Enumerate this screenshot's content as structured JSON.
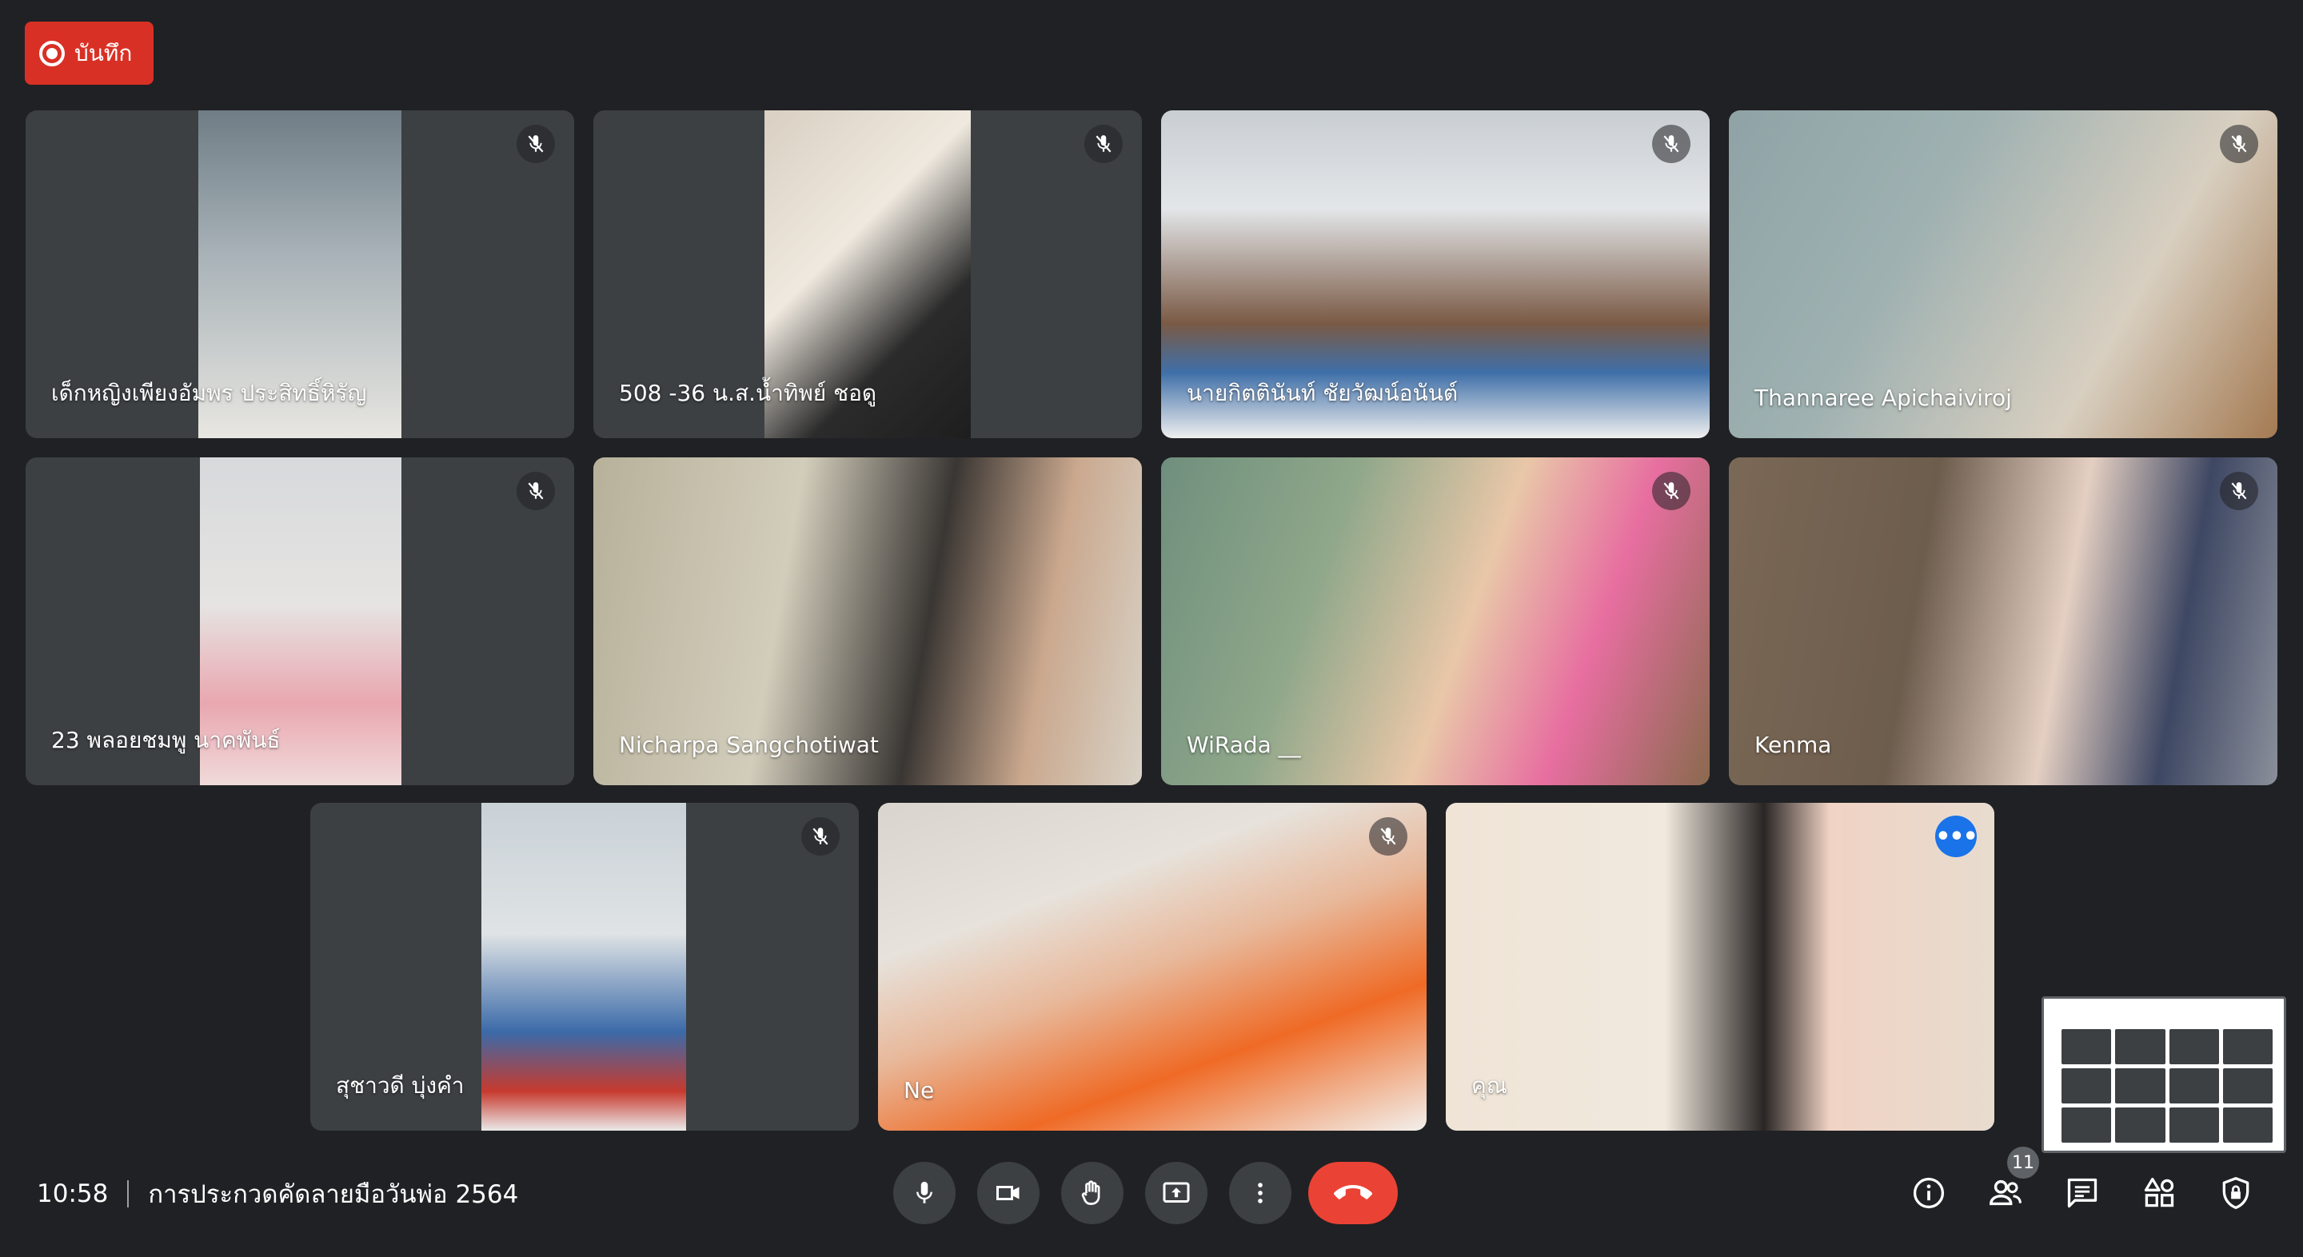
{
  "recording": {
    "label": "บันทึก"
  },
  "participants": [
    {
      "name": "เด็กหญิงเพียงอัมพร ประสิทธิ์หิรัญ",
      "muted": true
    },
    {
      "name": "508 -36 น.ส.น้ำทิพย์ ชอดู",
      "muted": true
    },
    {
      "name": "นายกิตตินันท์ ชัยวัฒน์อนันต์",
      "muted": true
    },
    {
      "name": "Thannaree Apichaiviroj",
      "muted": true
    },
    {
      "name": "23 พลอยชมพู นาคพันธ์",
      "muted": true
    },
    {
      "name": "Nicharpa Sangchotiwat",
      "muted": false
    },
    {
      "name": "WiRada __",
      "muted": true
    },
    {
      "name": "Kenma",
      "muted": true
    },
    {
      "name": "สุชาวดี บุ่งคำ",
      "muted": true
    },
    {
      "name": "Ne",
      "muted": true
    },
    {
      "name": "คุณ",
      "muted": false
    }
  ],
  "meeting": {
    "time": "10:58",
    "title": "การประกวดคัดลายมือวันพ่อ 2564"
  },
  "people_count": "11",
  "controls": [
    "microphone",
    "camera",
    "raise-hand",
    "present",
    "more-options",
    "leave-call"
  ],
  "right_controls": [
    "info",
    "people",
    "chat",
    "activities",
    "host-controls"
  ],
  "accent": "#1a73e8",
  "end_call_color": "#ea4335"
}
